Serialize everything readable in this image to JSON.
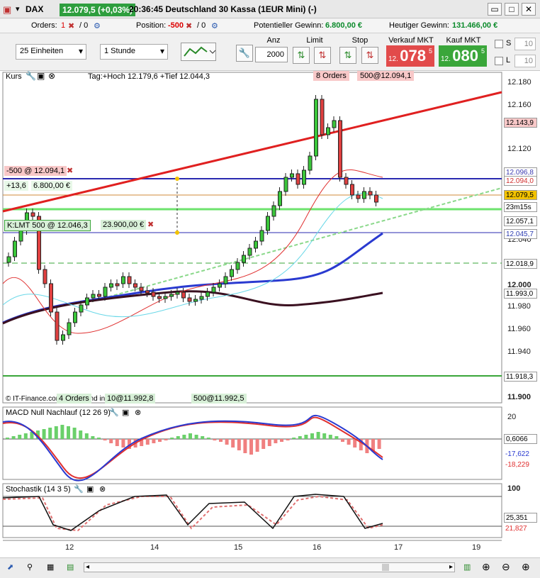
{
  "window": {
    "symbol": "DAX",
    "price_badge": "12.079,5 (+0,03%)",
    "description": "20:36:45 Deutschland 30 Kassa (1EUR Mini) (-)"
  },
  "orderbar": {
    "orders_label": "Orders:",
    "orders_value": "1",
    "orders_second": "/ 0",
    "position_label": "Position:",
    "position_value": "-500",
    "position_second": "/ 0",
    "potential_label": "Potentieller Gewinn:",
    "potential_value": "6.800,00 €",
    "today_label": "Heutiger Gewinn:",
    "today_value": "131.466,00 €"
  },
  "toolbar": {
    "units": "25 Einheiten",
    "interval": "1 Stunde",
    "anz_label": "Anz",
    "anz_value": "2000",
    "limit_label": "Limit",
    "stop_label": "Stop",
    "sell_label": "Verkauf MKT",
    "sell_small": "12.",
    "sell_big": "078",
    "sell_sup": "5",
    "buy_label": "Kauf MKT",
    "buy_small": "12.",
    "buy_big": "080",
    "buy_sup": "5",
    "s_label": "S",
    "s_value": "10",
    "l_label": "L",
    "l_value": "10"
  },
  "chart": {
    "main_label": "Kurs",
    "tag_info": "Tag:+Hoch 12.179,6 +Tief 12.044,3",
    "orders_tag": "8 Orders",
    "top_order_tag": "500@12.094,1",
    "short_position": "-500 @ 12.094,1",
    "pl_points": "+13,6",
    "pl_value": "6.800,00 €",
    "lmt_order": "K:LMT  500 @ 12.046,3",
    "lmt_value": "23.900,00 €",
    "copyright": "© IT-Finance.com Daten sind indikativ",
    "bottom_tag1": "4 Orders",
    "bottom_tag2": "10@11.992,8",
    "bottom_tag3": "500@11.992,5",
    "timer": "23m15s",
    "y_ticks": [
      "12.180",
      "12.160",
      "12.120",
      "12.040",
      "12.000",
      "11.980",
      "11.960",
      "11.940",
      "11.900"
    ],
    "price_tags": [
      {
        "label": "12.143,9",
        "color": "#e24b4b"
      },
      {
        "label": "12.096,8",
        "color": "#3a3ab0"
      },
      {
        "label": "12.094,0",
        "color": "#e24b4b"
      },
      {
        "label": "12.079,5",
        "color": "#f2c200"
      },
      {
        "label": "12.057,1",
        "color": "#3aa63a"
      },
      {
        "label": "12.045,7",
        "color": "#2a3ab0"
      },
      {
        "label": "12.018,9",
        "color": "#3aa63a"
      },
      {
        "label": "11.993,0",
        "color": "#3a1a1a"
      },
      {
        "label": "11.918,3",
        "color": "#3aa63a"
      }
    ],
    "x_ticks": [
      "12",
      "14",
      "15",
      "16",
      "17",
      "19"
    ]
  },
  "macd": {
    "label": "MACD Null Nachlauf (12 26 9)",
    "tick20": "20",
    "v1": "0,6066",
    "v2": "-17,622",
    "v3": "-18,229"
  },
  "stoch": {
    "label": "Stochastik (14 3 5)",
    "tick100": "100",
    "v1": "25,351",
    "v2": "21,827"
  }
}
